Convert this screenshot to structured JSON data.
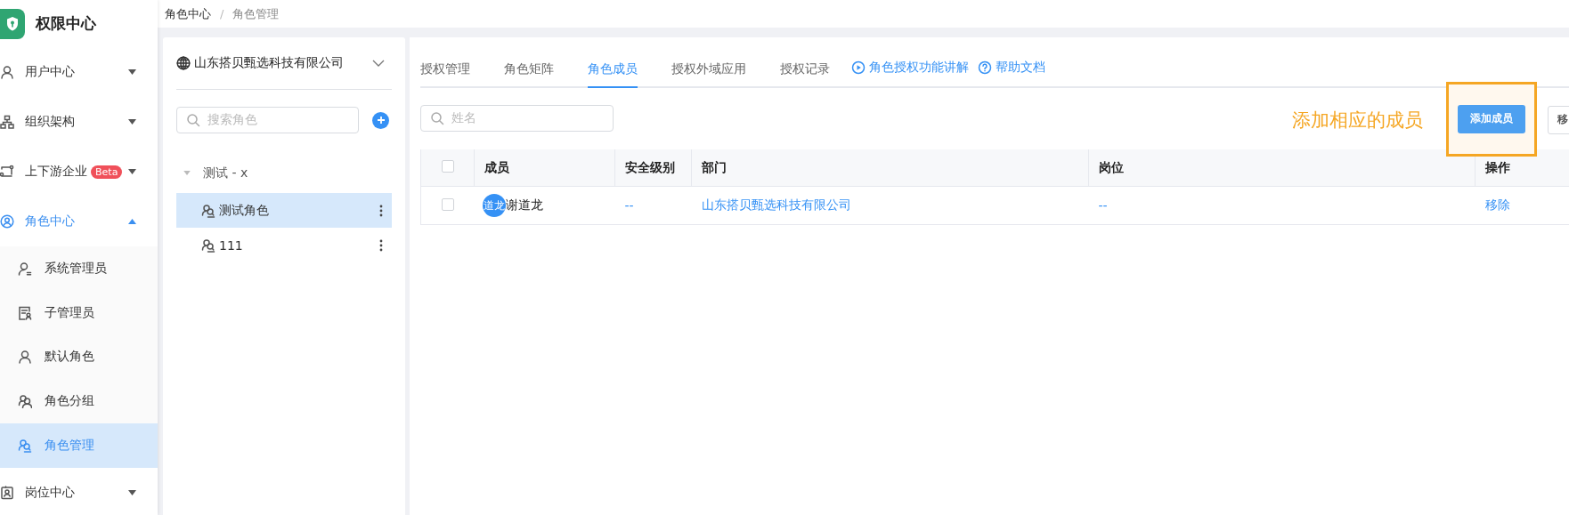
{
  "app": {
    "title": "权限中心"
  },
  "sidebar": {
    "items": [
      {
        "label": "用户中心",
        "kind": "user",
        "expanded": false
      },
      {
        "label": "组织架构",
        "kind": "org",
        "expanded": false
      },
      {
        "label": "上下游企业",
        "kind": "flow",
        "badge": "Beta",
        "expanded": false
      },
      {
        "label": "角色中心",
        "kind": "circle",
        "expanded": true,
        "children": [
          {
            "label": "系统管理员",
            "kind": "admin",
            "selected": false
          },
          {
            "label": "子管理员",
            "kind": "document",
            "selected": false
          },
          {
            "label": "默认角色",
            "kind": "user",
            "selected": false
          },
          {
            "label": "角色分组",
            "kind": "group",
            "selected": false
          },
          {
            "label": "角色管理",
            "kind": "role",
            "selected": true
          }
        ]
      },
      {
        "label": "岗位中心",
        "kind": "badge",
        "expanded": false
      }
    ]
  },
  "breadcrumb": {
    "items": [
      "角色中心",
      "角色管理"
    ],
    "separator": "/"
  },
  "role_panel": {
    "company": "山东搭贝甄选科技有限公司",
    "search": {
      "placeholder": "搜索角色"
    },
    "groups": [
      {
        "label": "测试 - x",
        "expanded": true,
        "children": [
          {
            "label": "测试角色",
            "selected": true
          },
          {
            "label": "111",
            "selected": false
          }
        ]
      }
    ]
  },
  "member_panel": {
    "tabs": [
      {
        "label": "授权管理",
        "selected": false
      },
      {
        "label": "角色矩阵",
        "selected": false
      },
      {
        "label": "角色成员",
        "selected": true
      },
      {
        "label": "授权外域应用",
        "selected": false
      },
      {
        "label": "授权记录",
        "selected": false
      }
    ],
    "links": [
      {
        "label": "角色授权功能讲解",
        "kind": "play"
      },
      {
        "label": "帮助文档",
        "kind": "help"
      }
    ],
    "search": {
      "placeholder": "姓名"
    },
    "annotation": "添加相应的成员",
    "buttons": [
      {
        "label": "添加成员",
        "kind": "primary"
      },
      {
        "label": "移",
        "kind": "default"
      }
    ],
    "table": {
      "select_all_checked": false,
      "columns": [
        "成员",
        "安全级别",
        "部门",
        "岗位",
        "操作"
      ],
      "rows": [
        {
          "checked": false,
          "avatar": "道龙",
          "member": "谢道龙",
          "security_level": "--",
          "department": "山东搭贝甄选科技有限公司",
          "position": "--",
          "action": "移除"
        }
      ]
    }
  }
}
